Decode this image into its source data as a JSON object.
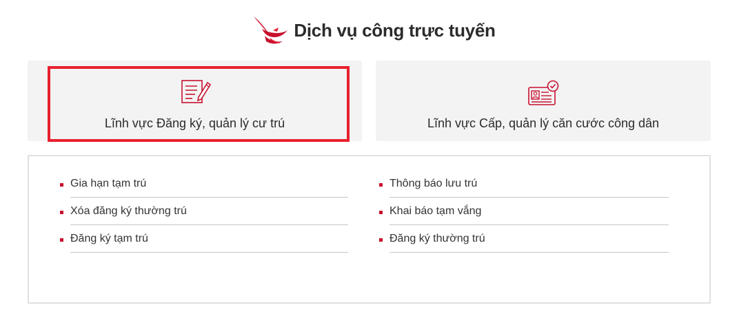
{
  "header": {
    "title": "Dịch vụ công trực tuyến",
    "logo_icon": "stork-emblem-icon"
  },
  "colors": {
    "accent": "#e8202e",
    "bullet": "#c8102e",
    "card_bg": "#f3f3f3"
  },
  "categories": [
    {
      "label": "Lĩnh vực Đăng ký, quản lý cư trú",
      "icon": "edit-document-icon",
      "selected": true
    },
    {
      "label": "Lĩnh vực Cấp, quản lý căn cước công dân",
      "icon": "id-card-check-icon",
      "selected": false
    }
  ],
  "services": {
    "left": [
      {
        "label": "Gia hạn tạm trú"
      },
      {
        "label": "Xóa đăng ký thường trú"
      },
      {
        "label": "Đăng ký tạm trú"
      }
    ],
    "right": [
      {
        "label": "Thông báo lưu trú"
      },
      {
        "label": "Khai báo tạm vắng"
      },
      {
        "label": "Đăng ký thường trú"
      }
    ]
  }
}
